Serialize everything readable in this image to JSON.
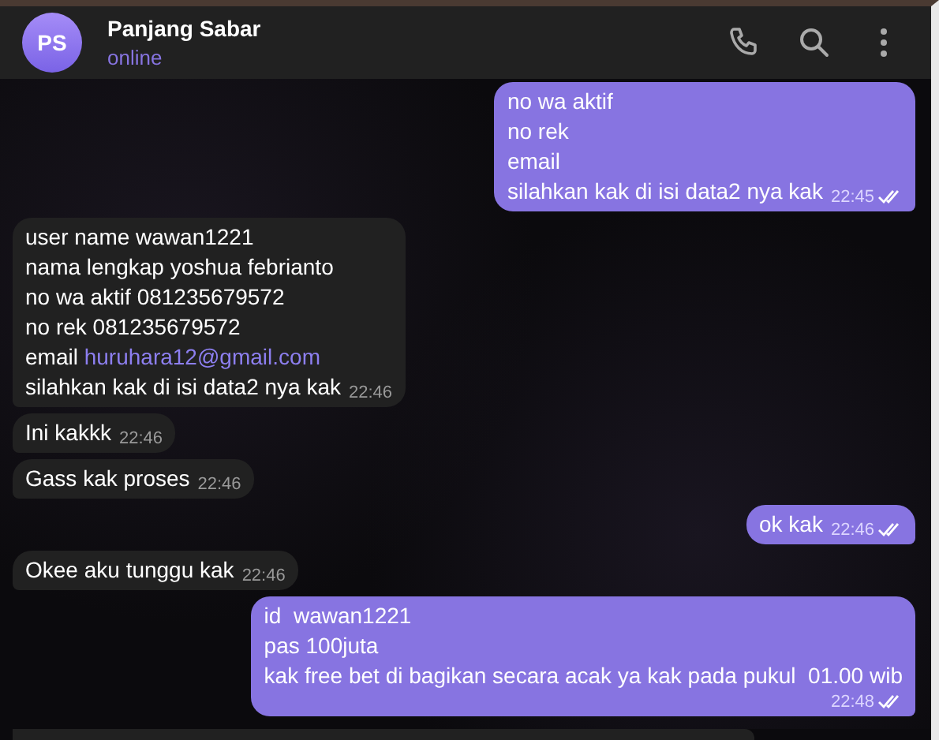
{
  "header": {
    "avatar_initials": "PS",
    "name": "Panjang Sabar",
    "status": "online"
  },
  "messages": [
    {
      "kind": "sent",
      "lines": [
        {
          "text": "no wa aktif"
        },
        {
          "text": "no rek"
        },
        {
          "text": "email"
        },
        {
          "text": "silahkan kak di isi data2 nya kak"
        }
      ],
      "time": "22:45",
      "read": true
    },
    {
      "kind": "received",
      "lines": [
        {
          "text": "user name wawan1221"
        },
        {
          "text": "nama lengkap yoshua febrianto"
        },
        {
          "text": "no wa aktif 081235679572"
        },
        {
          "text": "no rek 081235679572"
        },
        {
          "text": "email",
          "link": "huruhara12@gmail.com"
        },
        {
          "text": "silahkan kak di isi data2 nya kak"
        }
      ],
      "time": "22:46"
    },
    {
      "kind": "received",
      "lines": [
        {
          "text": "Ini kakkk"
        }
      ],
      "time": "22:46"
    },
    {
      "kind": "received",
      "lines": [
        {
          "text": "Gass kak proses"
        }
      ],
      "time": "22:46"
    },
    {
      "kind": "sent",
      "lines": [
        {
          "text": "ok kak"
        }
      ],
      "time": "22:46",
      "read": true
    },
    {
      "kind": "received",
      "lines": [
        {
          "text": "Okee aku tunggu kak"
        }
      ],
      "time": "22:46"
    },
    {
      "kind": "sent",
      "lines": [
        {
          "text": "id  wawan1221"
        },
        {
          "text": "pas 100juta"
        },
        {
          "text": "kak free bet di bagikan secara acak ya kak pada pukul  01.00 wib"
        }
      ],
      "time": "22:48",
      "read": true,
      "time_below": true
    }
  ]
}
